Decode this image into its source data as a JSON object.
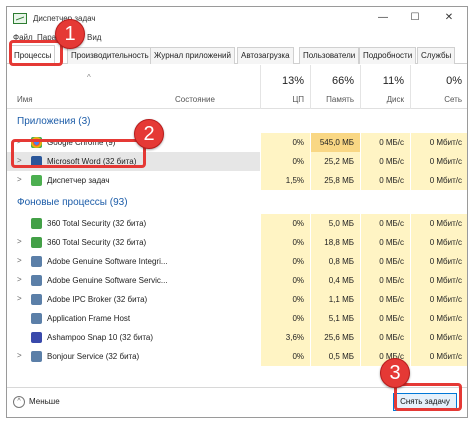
{
  "window": {
    "title": "Диспетчер задач"
  },
  "title_buttons": {
    "minimize": "—",
    "maximize": "☐",
    "close": "✕"
  },
  "menu": [
    "Файл",
    "Параметры",
    "Вид"
  ],
  "tabs": [
    "Процессы",
    "Производительность",
    "Журнал приложений",
    "Автозагрузка",
    "Пользователи",
    "Подробности",
    "Службы"
  ],
  "columns": {
    "name": "Имя",
    "status": "Состояние",
    "cpu": {
      "pct": "13%",
      "label": "ЦП"
    },
    "memory": {
      "pct": "66%",
      "label": "Память"
    },
    "disk": {
      "pct": "11%",
      "label": "Диск"
    },
    "network": {
      "pct": "0%",
      "label": "Сеть"
    }
  },
  "groups": {
    "apps_title": "Приложения (3)",
    "bg_title": "Фоновые процессы (93)"
  },
  "apps": [
    {
      "name": "Google Chrome (9)",
      "icon": "chrome-icon",
      "cpu": "0%",
      "mem": "545,0 МБ",
      "disk": "0 МБ/с",
      "net": "0 Мбит/с"
    },
    {
      "name": "Microsoft Word (32 бита)",
      "icon": "word-icon",
      "cpu": "0%",
      "mem": "25,2 МБ",
      "disk": "0 МБ/с",
      "net": "0 Мбит/с"
    },
    {
      "name": "Диспетчер задач",
      "icon": "task-manager-icon",
      "cpu": "1,5%",
      "mem": "25,8 МБ",
      "disk": "0 МБ/с",
      "net": "0 Мбит/с"
    }
  ],
  "background": [
    {
      "name": "360 Total Security (32 бита)",
      "icon": "shield-icon",
      "cpu": "0%",
      "mem": "5,0 МБ",
      "disk": "0 МБ/с",
      "net": "0 Мбит/с"
    },
    {
      "name": "360 Total Security (32 бита)",
      "icon": "shield-icon",
      "cpu": "0%",
      "mem": "18,8 МБ",
      "disk": "0 МБ/с",
      "net": "0 Мбит/с"
    },
    {
      "name": "Adobe Genuine Software Integri...",
      "icon": "service-icon",
      "cpu": "0%",
      "mem": "0,8 МБ",
      "disk": "0 МБ/с",
      "net": "0 Мбит/с"
    },
    {
      "name": "Adobe Genuine Software Servic...",
      "icon": "service-icon",
      "cpu": "0%",
      "mem": "0,4 МБ",
      "disk": "0 МБ/с",
      "net": "0 Мбит/с"
    },
    {
      "name": "Adobe IPC Broker (32 бита)",
      "icon": "service-icon",
      "cpu": "0%",
      "mem": "1,1 МБ",
      "disk": "0 МБ/с",
      "net": "0 Мбит/с"
    },
    {
      "name": "Application Frame Host",
      "icon": "service-icon",
      "cpu": "0%",
      "mem": "5,1 МБ",
      "disk": "0 МБ/с",
      "net": "0 Мбит/с"
    },
    {
      "name": "Ashampoo Snap 10 (32 бита)",
      "icon": "snap-icon",
      "cpu": "3,6%",
      "mem": "25,6 МБ",
      "disk": "0 МБ/с",
      "net": "0 Мбит/с"
    },
    {
      "name": "Bonjour Service (32 бита)",
      "icon": "service-icon",
      "cpu": "0%",
      "mem": "0,5 МБ",
      "disk": "0 МБ/с",
      "net": "0 Мбит/с"
    }
  ],
  "footer": {
    "less_label": "Меньше",
    "end_task_label": "Снять задачу"
  },
  "annotations": [
    "1",
    "2",
    "3"
  ],
  "colors": {
    "accent": "#1c5ca8",
    "highlight": "#e53935",
    "heat_light": "#fff4c4",
    "heat_hot": "#f9d784"
  }
}
